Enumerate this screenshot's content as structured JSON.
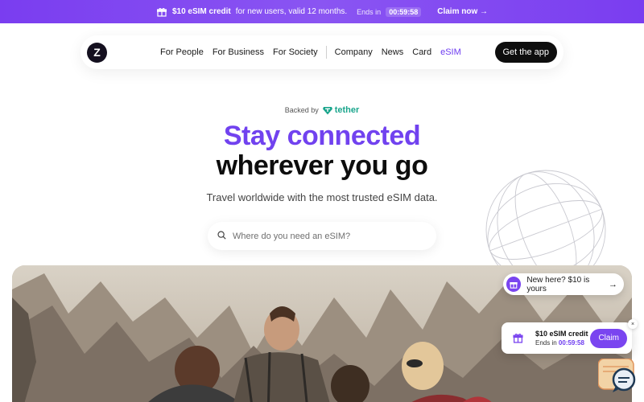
{
  "promo": {
    "credit": "$10 eSIM credit",
    "rest": "for new users, valid 12 months.",
    "ends_label": "Ends in",
    "timer": "00:59:58",
    "claim": "Claim now →"
  },
  "nav": {
    "logo": "Z",
    "links": [
      "For People",
      "For Business",
      "For Society",
      "Company",
      "News",
      "Card",
      "eSIM"
    ],
    "active": "eSIM",
    "cta": "Get the app"
  },
  "hero": {
    "backed_by": "Backed by",
    "backer": "tether",
    "title_line1": "Stay connected",
    "title_line2": "wherever you go",
    "subtitle": "Travel worldwide with the most trusted eSIM data.",
    "search_placeholder": "Where do you need an eSIM?"
  },
  "toast": {
    "text": "New here? $10 is yours",
    "arrow": "→"
  },
  "offer_card": {
    "title": "$10 eSIM credit",
    "ends_label": "Ends in",
    "timer": "00:59:58",
    "button": "Claim",
    "close": "×"
  },
  "colors": {
    "brand": "#7a45f0",
    "title_accent": "#7142ef",
    "tether": "#1aa58c"
  },
  "icons": [
    "gift-icon",
    "search-icon",
    "tether-logo-icon",
    "globe-icon",
    "chat-icon",
    "close-icon",
    "arrow-right-icon"
  ]
}
